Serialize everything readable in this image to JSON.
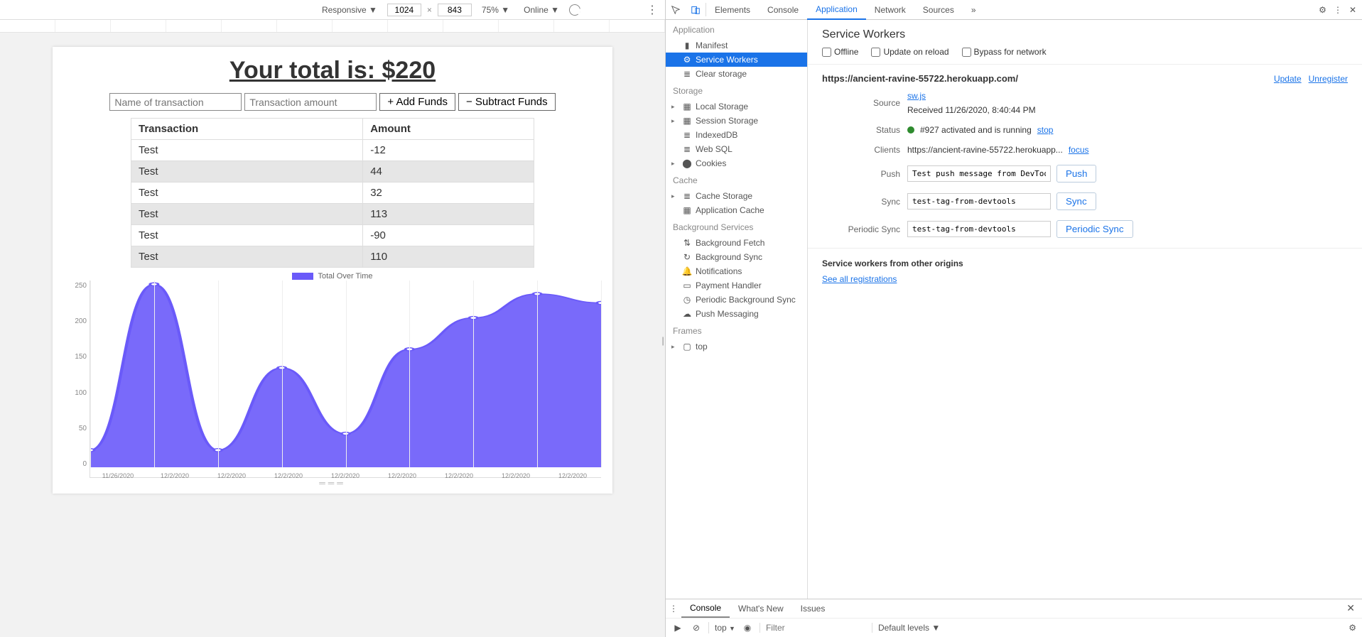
{
  "device_toolbar": {
    "mode": "Responsive",
    "width": "1024",
    "height": "843",
    "zoom": "75%",
    "throttle": "Online"
  },
  "app": {
    "title": "Your total is: $220",
    "name_placeholder": "Name of transaction",
    "amount_placeholder": "Transaction amount",
    "add_btn": "+ Add Funds",
    "sub_btn": "− Subtract Funds",
    "th_tx": "Transaction",
    "th_amt": "Amount",
    "rows": [
      {
        "t": "Test",
        "a": "-12"
      },
      {
        "t": "Test",
        "a": "44"
      },
      {
        "t": "Test",
        "a": "32"
      },
      {
        "t": "Test",
        "a": "113"
      },
      {
        "t": "Test",
        "a": "-90"
      },
      {
        "t": "Test",
        "a": "110"
      }
    ],
    "legend": "Total Over Time"
  },
  "chart_data": {
    "type": "area",
    "title": "Total Over Time",
    "ylabel": "",
    "xlabel": "",
    "ylim": [
      0,
      250
    ],
    "yticks": [
      "250",
      "200",
      "150",
      "100",
      "50",
      "0"
    ],
    "categories": [
      "11/26/2020",
      "12/2/2020",
      "12/2/2020",
      "12/2/2020",
      "12/2/2020",
      "12/2/2020",
      "12/2/2020",
      "12/2/2020",
      "12/2/2020"
    ],
    "values": [
      23,
      245,
      23,
      133,
      45,
      158,
      200,
      232,
      220
    ],
    "series_color": "#6a5af9"
  },
  "devtools": {
    "tabs": [
      "Elements",
      "Console",
      "Application",
      "Network",
      "Sources"
    ],
    "active_tab": "Application",
    "more": "»"
  },
  "sidebar": {
    "groups": [
      {
        "title": "Application",
        "items": [
          {
            "icon": "file",
            "label": "Manifest"
          },
          {
            "icon": "gear",
            "label": "Service Workers",
            "sel": true
          },
          {
            "icon": "db",
            "label": "Clear storage"
          }
        ]
      },
      {
        "title": "Storage",
        "items": [
          {
            "icon": "grid",
            "label": "Local Storage",
            "exp": true
          },
          {
            "icon": "grid",
            "label": "Session Storage",
            "exp": true
          },
          {
            "icon": "db",
            "label": "IndexedDB"
          },
          {
            "icon": "db",
            "label": "Web SQL"
          },
          {
            "icon": "cookie",
            "label": "Cookies",
            "exp": true
          }
        ]
      },
      {
        "title": "Cache",
        "items": [
          {
            "icon": "db",
            "label": "Cache Storage",
            "exp": true
          },
          {
            "icon": "grid",
            "label": "Application Cache"
          }
        ]
      },
      {
        "title": "Background Services",
        "items": [
          {
            "icon": "swap",
            "label": "Background Fetch"
          },
          {
            "icon": "sync",
            "label": "Background Sync"
          },
          {
            "icon": "bell",
            "label": "Notifications"
          },
          {
            "icon": "card",
            "label": "Payment Handler"
          },
          {
            "icon": "clock",
            "label": "Periodic Background Sync"
          },
          {
            "icon": "cloud",
            "label": "Push Messaging"
          }
        ]
      },
      {
        "title": "Frames",
        "items": [
          {
            "icon": "frame",
            "label": "top",
            "exp": true
          }
        ]
      }
    ]
  },
  "sw": {
    "title": "Service Workers",
    "chk_offline": "Offline",
    "chk_update": "Update on reload",
    "chk_bypass": "Bypass for network",
    "origin": "https://ancient-ravine-55722.herokuapp.com/",
    "link_update": "Update",
    "link_unreg": "Unregister",
    "k_source": "Source",
    "v_source": "sw.js",
    "v_received": "Received 11/26/2020, 8:40:44 PM",
    "k_status": "Status",
    "v_status": "#927 activated and is running",
    "link_stop": "stop",
    "k_clients": "Clients",
    "v_clients": "https://ancient-ravine-55722.herokuapp...",
    "link_focus": "focus",
    "k_push": "Push",
    "v_push": "Test push message from DevToo",
    "btn_push": "Push",
    "k_sync": "Sync",
    "v_sync": "test-tag-from-devtools",
    "btn_sync": "Sync",
    "k_psync": "Periodic Sync",
    "v_psync": "test-tag-from-devtools",
    "btn_psync": "Periodic Sync",
    "other_title": "Service workers from other origins",
    "other_link": "See all registrations"
  },
  "console": {
    "tabs": [
      "Console",
      "What's New",
      "Issues"
    ],
    "ctx": "top",
    "filter_ph": "Filter",
    "levels": "Default levels"
  }
}
